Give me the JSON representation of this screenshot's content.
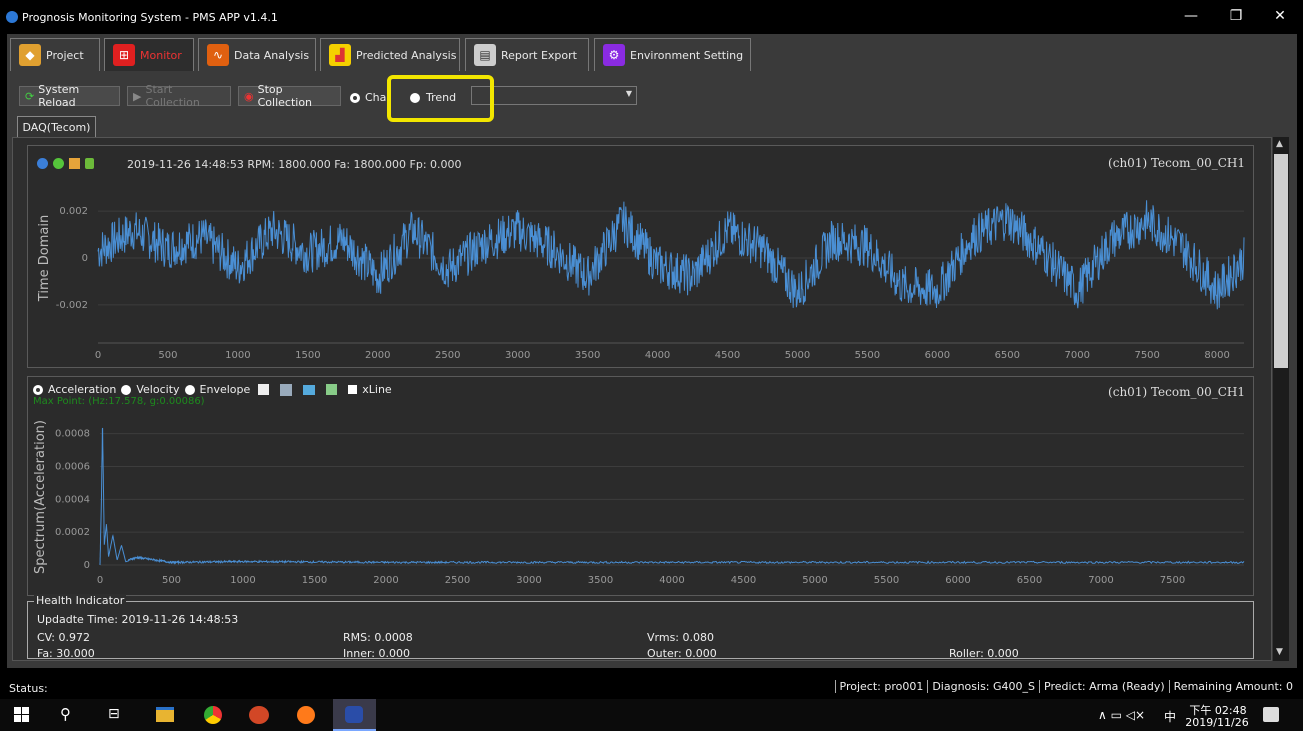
{
  "window": {
    "title": "Prognosis Monitoring System - PMS APP v1.4.1",
    "min": "—",
    "restore": "❐",
    "close": "✕"
  },
  "tabs": [
    {
      "label": "Project",
      "icon": "tag-icon",
      "color": "#e0a030"
    },
    {
      "label": "Monitor",
      "icon": "monitor-tree-icon",
      "color": "#e02020"
    },
    {
      "label": "Data Analysis",
      "icon": "waveform-icon",
      "color": "#e06010"
    },
    {
      "label": "Predicted  Analysis",
      "icon": "bar-chart-icon",
      "color": "#e8b800"
    },
    {
      "label": "Report Export",
      "icon": "report-icon",
      "color": "#999999"
    },
    {
      "label": "Environment Setting",
      "icon": "gears-icon",
      "color": "#8a2be2"
    }
  ],
  "toolbar": {
    "reload": "System Reload",
    "start": "Start Collection",
    "stop": "Stop Collection",
    "chart": "Cha",
    "trend": "Trend",
    "combo_value": ""
  },
  "subtab": "DAQ(Tecom)",
  "time_panel": {
    "info": "2019-11-26 14:48:53   RPM: 1800.000   Fa: 1800.000   Fp: 0.000",
    "channel": "(ch01) Tecom_00_CH1",
    "ylabel": "Time Domain",
    "yticks": [
      "0.002",
      "0",
      "-0.002"
    ],
    "xticks": [
      "0",
      "500",
      "1000",
      "1500",
      "2000",
      "2500",
      "3000",
      "3500",
      "4000",
      "4500",
      "5000",
      "5500",
      "6000",
      "6500",
      "7000",
      "7500",
      "8000"
    ]
  },
  "spectrum_panel": {
    "options": {
      "acceleration": "Acceleration",
      "velocity": "Velocity",
      "envelope": "Envelope",
      "xline": "xLine"
    },
    "maxpoint": "Max Point: (Hz:17.578, g:0.00086)",
    "channel": "(ch01) Tecom_00_CH1",
    "ylabel": "Spectrum(Acceleration)",
    "yticks": [
      "0.0008",
      "0.0006",
      "0.0004",
      "0.0002",
      "0"
    ],
    "xticks": [
      "0",
      "500",
      "1000",
      "1500",
      "2000",
      "2500",
      "3000",
      "3500",
      "4000",
      "4500",
      "5000",
      "5500",
      "6000",
      "6500",
      "7000",
      "7500"
    ]
  },
  "health": {
    "legend": "Health Indicator",
    "update": "Updadte Time: 2019-11-26 14:48:53",
    "cv": "CV: 0.972",
    "rms": "RMS: 0.0008",
    "vrms": "Vrms: 0.080",
    "fa": "Fa: 30.000",
    "inner": "Inner: 0.000",
    "outer": "Outer: 0.000",
    "roller": "Roller: 0.000"
  },
  "status": {
    "label": "Status:",
    "project": "Project: pro001",
    "diagnosis": "Diagnosis: G400_S",
    "predict": "Predict: Arma (Ready)",
    "remaining": "Remaining Amount: 0"
  },
  "taskbar": {
    "time": "下午 02:48",
    "date": "2019/11/26",
    "ime": "中",
    "tray": "∧  ▭  ◁×"
  },
  "chart_data": [
    {
      "type": "line",
      "title": "",
      "ylabel": "Time Domain",
      "xlabel": "",
      "xlim": [
        0,
        8192
      ],
      "ylim": [
        -0.0035,
        0.0035
      ],
      "series": [
        {
          "x": [
            0,
            250,
            500,
            750,
            1000,
            1250,
            1500,
            1750,
            2000,
            2250,
            2500,
            2750,
            3000,
            3250,
            3500,
            3750,
            4000,
            4250,
            4500,
            4750,
            5000,
            5250,
            5500,
            5750,
            6000,
            6250,
            6500,
            6750,
            7000,
            7250,
            7500,
            7750,
            8000,
            8192
          ],
          "values": [
            0.0003,
            0.0012,
            0.0004,
            0.0009,
            -0.0004,
            0.0012,
            0.0002,
            0.0008,
            -0.0008,
            0.0012,
            -0.0005,
            0.0006,
            0.0012,
            0.0004,
            -0.0008,
            0.0016,
            -0.0003,
            -0.0008,
            0.0012,
            0.0004,
            -0.0015,
            0.0008,
            0.0005,
            -0.0012,
            -0.0014,
            0.0009,
            0.0017,
            0.0003,
            -0.0014,
            0.0008,
            0.0016,
            0.0005,
            -0.0014,
            0.0
          ]
        }
      ]
    },
    {
      "type": "line",
      "title": "",
      "ylabel": "Spectrum(Acceleration)",
      "xlabel": "",
      "xlim": [
        0,
        8000
      ],
      "ylim": [
        0,
        0.00095
      ],
      "series": [
        {
          "x": [
            0,
            10,
            17.578,
            30,
            45,
            60,
            90,
            120,
            150,
            180,
            260,
            500,
            1000,
            2000,
            4000,
            6000,
            8000
          ],
          "values": [
            0.0,
            0.0004,
            0.00086,
            0.00012,
            0.00025,
            5e-05,
            0.00018,
            3e-05,
            0.00012,
            2e-05,
            4e-05,
            1e-05,
            1.5e-05,
            1e-05,
            1e-05,
            1e-05,
            1e-05
          ]
        }
      ]
    }
  ]
}
